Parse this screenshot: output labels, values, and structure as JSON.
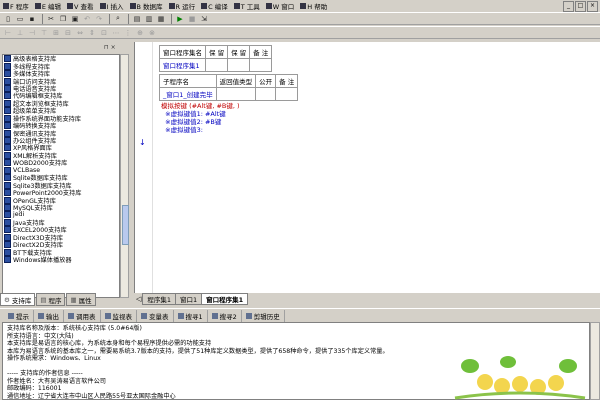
{
  "menubar": {
    "items": [
      "F 程序",
      "E 编辑",
      "V 查看",
      "I 插入",
      "B 数据库",
      "R 运行",
      "C 编译",
      "T 工具",
      "W 窗口",
      "H 帮助"
    ],
    "window_buttons": [
      "_",
      "□",
      "×"
    ]
  },
  "leftpanel": {
    "libraries": [
      "高级表格支持库",
      "多线程支持库",
      "多媒体支持库",
      "端口访问支持库",
      "电话语音支持库",
      "代码编辑框支持库",
      "超文本浏览框支持库",
      "超级菜单支持库",
      "操作系统界面功能支持库",
      "编码转换支持库",
      "保密通讯支持库",
      "办公组件支持库",
      "XP风格界面库",
      "XML解析支持库",
      "WOBD2000支持库",
      "VCLBase",
      "Sqlite数据库支持库",
      "Sqlite3数据库支持库",
      "PowerPoint2000支持库",
      "OPenGL支持库",
      "MySQL支持库",
      "jedi",
      "Java支持库",
      "EXCEL2000支持库",
      "DirectX3D支持库",
      "DirectX2D支持库",
      "BT下载支持库",
      "Windows媒体播放器"
    ],
    "tabs": [
      "支持库",
      "程序",
      "属性"
    ]
  },
  "editor": {
    "table1": {
      "headers": [
        "窗口程序集名",
        "保 留",
        "保 留",
        "备 注"
      ],
      "row": [
        "窗口程序集1",
        "",
        "",
        ""
      ]
    },
    "table2": {
      "headers": [
        "子程序名",
        "返回值类型",
        "公开",
        "备 注"
      ],
      "row": [
        "_窗口1_创建完毕",
        "",
        "",
        ""
      ]
    },
    "code_lines": [
      {
        "text": "模拟按键 (#Alt键, #B键, )",
        "color": "#c00000"
      },
      {
        "text": "  ※虚拟键值1: #Alt键",
        "color": "#0000c0"
      },
      {
        "text": "  ※虚拟键值2: #B键",
        "color": "#0000c0"
      },
      {
        "text": "  ※虚拟键值3:",
        "color": "#0000c0"
      }
    ],
    "tabs": [
      "程序集1",
      "窗口1",
      "窗口程序集1"
    ]
  },
  "bottom": {
    "tabs": [
      "提示",
      "输出",
      "调用表",
      "监视表",
      "变量表",
      "搜寻1",
      "搜寻2",
      "剪辑历史"
    ],
    "output_lines": [
      "    支持库名称及版本：系统核心支持库 (5.0#64版)",
      "    所支持语言：中文(大陆)",
      "    本支持库是易语言的核心库，为系统本身和每个易程序提供必需的功能支持",
      "    本库为易语言系统的基本库之一，需要易系统3.7版本的支持，提供了51种库定义数据类型，提供了658种命令，提供了335个库定义常量。",
      "    操作系统需求：Windows、Linux",
      "",
      "----- 支持库的作者信息 -----",
      "作者姓名：大有吴涛易语言软件公司",
      "邮政编码：116001",
      "通信地址：辽宁省大连市中山区人民路55号亚太国际金融中心"
    ]
  }
}
